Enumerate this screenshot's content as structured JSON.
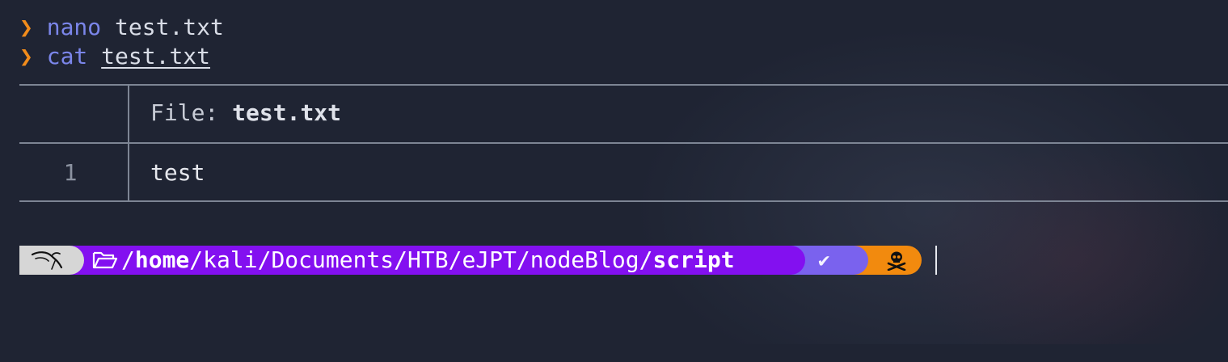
{
  "terminal": {
    "history": [
      {
        "prompt_glyph": "❯",
        "command": "nano",
        "argument": "test.txt"
      },
      {
        "prompt_glyph": "❯",
        "command": "cat",
        "argument": "test.txt"
      }
    ],
    "bat_output": {
      "header_label": "File: ",
      "file_name": "test.txt",
      "lines": [
        {
          "number": "1",
          "text": "test"
        }
      ]
    },
    "prompt": {
      "os_icon": "kali-dragon-icon",
      "folder_icon": "folder-open-icon",
      "path_prefix": "/",
      "path_home": "home",
      "path_middle": "/kali/Documents/HTB/eJPT/nodeBlog/",
      "path_current": "script",
      "status_icon": "check-icon",
      "status_glyph": "✔",
      "user_icon": "skull-crossbones-icon"
    },
    "colors": {
      "background": "#1f2433",
      "chevron": "#f28c1b",
      "command": "#7b86ea",
      "path_segment": "#8310f0",
      "status_segment": "#7a62ee",
      "user_segment": "#f28a0e",
      "os_segment": "#d6d6d6"
    }
  }
}
